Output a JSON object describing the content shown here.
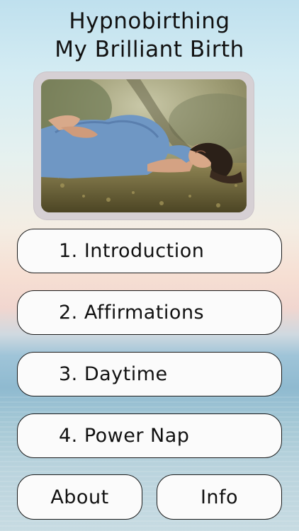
{
  "app": {
    "title_line1": "Hypnobirthing",
    "title_line2": "My Brilliant Birth"
  },
  "hero_image": {
    "description_icon": "pregnant-woman-relaxing-photo"
  },
  "menu": {
    "items": [
      {
        "label": "1. Introduction"
      },
      {
        "label": "2. Affirmations"
      },
      {
        "label": "3. Daytime"
      },
      {
        "label": "4. Power Nap"
      }
    ]
  },
  "footer": {
    "about_label": "About",
    "info_label": "Info"
  },
  "colors": {
    "button_bg": "#fbfbfb",
    "button_border": "#1a1a1a",
    "text": "#111111",
    "frame": "#d6d0d4"
  }
}
